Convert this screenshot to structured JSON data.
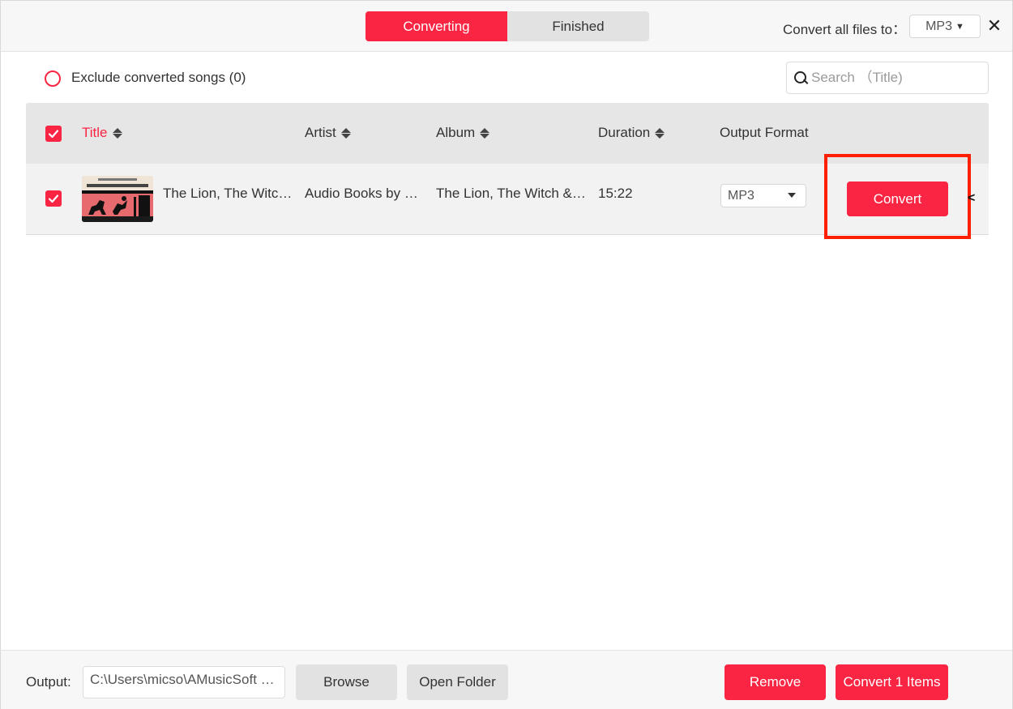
{
  "header": {
    "tabs": [
      {
        "label": "Converting",
        "active": true
      },
      {
        "label": "Finished",
        "active": false
      }
    ],
    "convert_all_label": "Convert all files to：",
    "convert_all_value": "MP3",
    "close_icon": "close-icon"
  },
  "filter": {
    "exclude_label": "Exclude converted songs (0)",
    "search_placeholder": "Search （Title)"
  },
  "table": {
    "columns": {
      "title": "Title",
      "artist": "Artist",
      "album": "Album",
      "duration": "Duration",
      "output_format": "Output Format"
    },
    "rows": [
      {
        "checked": true,
        "title": "The Lion, The Witc…",
        "artist": "Audio Books by …",
        "album": "The Lion, The Witch &…",
        "duration": "15:22",
        "format": "MP3",
        "convert_label": "Convert"
      }
    ]
  },
  "footer": {
    "output_label": "Output:",
    "output_path": "C:\\Users\\micso\\AMusicSoft …",
    "browse_label": "Browse",
    "open_folder_label": "Open Folder",
    "remove_label": "Remove",
    "convert_items_label": "Convert 1 Items"
  },
  "colors": {
    "accent": "#fa2543",
    "highlight": "#ff1e00"
  }
}
